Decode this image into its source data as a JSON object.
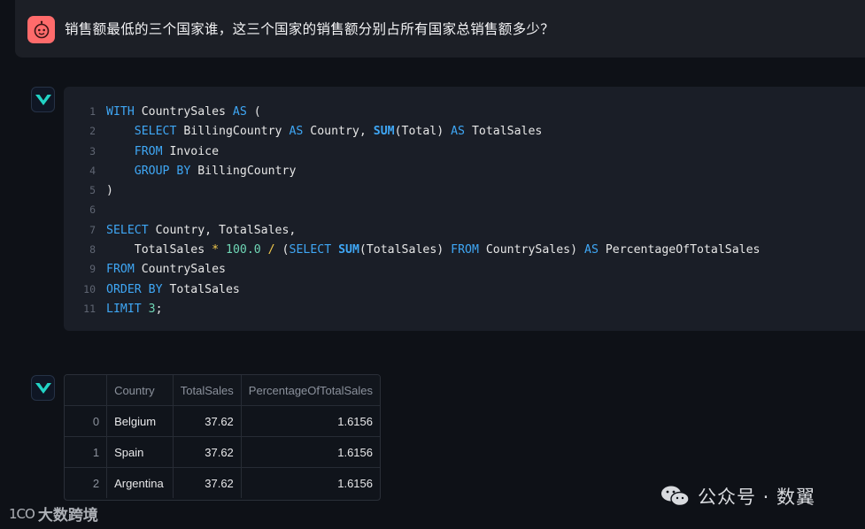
{
  "question": {
    "text": "销售额最低的三个国家谁，这三个国家的销售额分别占所有国家总销售额多少？"
  },
  "icons": {
    "user_avatar": "robot-face-icon",
    "assistant_avatar": "check-mark-icon",
    "watermark_wechat": "wechat-icon"
  },
  "colors": {
    "background": "#0e1117",
    "keyword": "#3fa7f5",
    "number": "#6fd6b5",
    "operator": "#f2c94c",
    "user_avatar_bg": "#ff6b6b",
    "assistant_avatar_accent": "#22d3c5"
  },
  "code": {
    "lines": [
      {
        "num": "1",
        "tokens": [
          [
            "kw",
            "WITH"
          ],
          [
            "t",
            " CountrySales "
          ],
          [
            "kw",
            "AS"
          ],
          [
            "t",
            " ("
          ]
        ]
      },
      {
        "num": "2",
        "tokens": [
          [
            "t",
            "    "
          ],
          [
            "kw",
            "SELECT"
          ],
          [
            "t",
            " BillingCountry "
          ],
          [
            "kw",
            "AS"
          ],
          [
            "t",
            " Country, "
          ],
          [
            "fn",
            "SUM"
          ],
          [
            "t",
            "(Total) "
          ],
          [
            "kw",
            "AS"
          ],
          [
            "t",
            " TotalSales"
          ]
        ]
      },
      {
        "num": "3",
        "tokens": [
          [
            "t",
            "    "
          ],
          [
            "kw",
            "FROM"
          ],
          [
            "t",
            " Invoice"
          ]
        ]
      },
      {
        "num": "4",
        "tokens": [
          [
            "t",
            "    "
          ],
          [
            "kw",
            "GROUP BY"
          ],
          [
            "t",
            " BillingCountry"
          ]
        ]
      },
      {
        "num": "5",
        "tokens": [
          [
            "t",
            ")"
          ]
        ]
      },
      {
        "num": "6",
        "tokens": []
      },
      {
        "num": "7",
        "tokens": [
          [
            "kw",
            "SELECT"
          ],
          [
            "t",
            " Country, TotalSales,"
          ]
        ]
      },
      {
        "num": "8",
        "tokens": [
          [
            "t",
            "    TotalSales "
          ],
          [
            "op",
            "*"
          ],
          [
            "t",
            " "
          ],
          [
            "num",
            "100.0"
          ],
          [
            "t",
            " "
          ],
          [
            "op",
            "/"
          ],
          [
            "t",
            " ("
          ],
          [
            "kw",
            "SELECT"
          ],
          [
            "t",
            " "
          ],
          [
            "fn",
            "SUM"
          ],
          [
            "t",
            "(TotalSales) "
          ],
          [
            "kw",
            "FROM"
          ],
          [
            "t",
            " CountrySales) "
          ],
          [
            "kw",
            "AS"
          ],
          [
            "t",
            " PercentageOfTotalSales"
          ]
        ]
      },
      {
        "num": "9",
        "tokens": [
          [
            "kw",
            "FROM"
          ],
          [
            "t",
            " CountrySales"
          ]
        ]
      },
      {
        "num": "10",
        "tokens": [
          [
            "kw",
            "ORDER BY"
          ],
          [
            "t",
            " TotalSales"
          ]
        ]
      },
      {
        "num": "11",
        "tokens": [
          [
            "kw",
            "LIMIT"
          ],
          [
            "t",
            " "
          ],
          [
            "num",
            "3"
          ],
          [
            "t",
            ";"
          ]
        ]
      }
    ]
  },
  "result_table": {
    "columns": [
      "",
      "Country",
      "TotalSales",
      "PercentageOfTotalSales"
    ],
    "rows": [
      [
        "0",
        "Belgium",
        "37.62",
        "1.6156"
      ],
      [
        "1",
        "Spain",
        "37.62",
        "1.6156"
      ],
      [
        "2",
        "Argentina",
        "37.62",
        "1.6156"
      ]
    ]
  },
  "watermarks": {
    "left_logo": "1CO",
    "left_text": "大数跨境",
    "right_text": "公众号 · 数翼"
  }
}
